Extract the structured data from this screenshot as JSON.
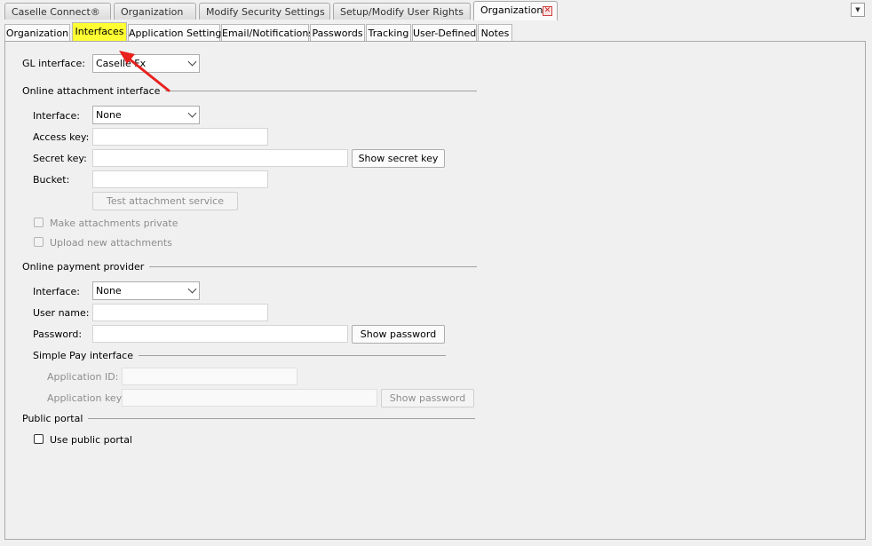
{
  "doc_tabs": [
    {
      "label": "Caselle Connect®"
    },
    {
      "label": "Organization"
    },
    {
      "label": "Modify Security Settings"
    },
    {
      "label": "Setup/Modify User Rights"
    },
    {
      "label": "Organization"
    }
  ],
  "page_tabs": [
    {
      "label": "Organization"
    },
    {
      "label": "Interfaces"
    },
    {
      "label": "Application Settings"
    },
    {
      "label": "Email/Notifications"
    },
    {
      "label": "Passwords"
    },
    {
      "label": "Tracking"
    },
    {
      "label": "User-Defined"
    },
    {
      "label": "Notes"
    }
  ],
  "selected_tab": "Interfaces",
  "highlight_color": "#ffff33",
  "arrow_color": "#e8201e",
  "gl": {
    "label": "GL interface:",
    "value": "Caselle Fx"
  },
  "attachment": {
    "section": "Online attachment interface",
    "interface_label": "Interface:",
    "interface_value": "None",
    "access_key_label": "Access key:",
    "secret_key_label": "Secret key:",
    "show_secret_button": "Show secret key",
    "bucket_label": "Bucket:",
    "test_button": "Test attachment service",
    "private_label": "Make attachments private",
    "upload_label": "Upload new attachments"
  },
  "payment": {
    "section": "Online payment provider",
    "interface_label": "Interface:",
    "interface_value": "None",
    "username_label": "User name:",
    "password_label": "Password:",
    "show_password_button": "Show password"
  },
  "simple_pay": {
    "section": "Simple Pay interface",
    "app_id_label": "Application ID:",
    "app_key_label": "Application key:",
    "show_password_button": "Show password"
  },
  "portal": {
    "section": "Public portal",
    "use_label": "Use public portal"
  }
}
